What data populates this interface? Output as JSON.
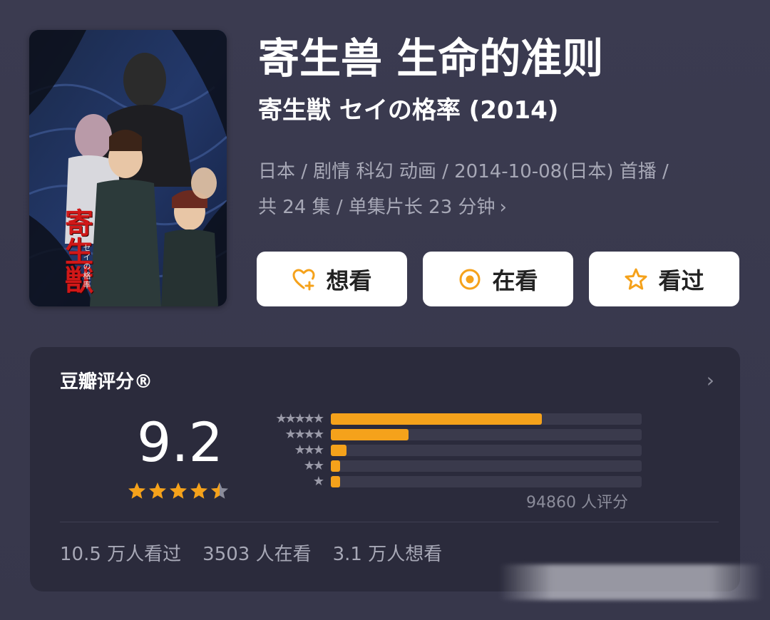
{
  "poster": {
    "title": "寄生獣",
    "subtitle": "セイの格率"
  },
  "header": {
    "title": "寄生兽 生命的准则",
    "subtitle": "寄生獣 セイの格率 (2014)"
  },
  "meta": {
    "line1": "日本 / 剧情 科幻 动画 / 2014-10-08(日本) 首播 /",
    "line2": "共 24 集 / 单集片长 23 分钟",
    "chevron": "›"
  },
  "actions": [
    {
      "label": "想看",
      "icon": "heart-plus-icon"
    },
    {
      "label": "在看",
      "icon": "target-circle-icon"
    },
    {
      "label": "看过",
      "icon": "star-outline-icon"
    }
  ],
  "rating": {
    "header": "豆瓣评分®",
    "chevron": "›",
    "score": "9.2",
    "stars_value": 4.5,
    "distribution": [
      {
        "stars": "★★★★★",
        "fraction": 0.68
      },
      {
        "stars": "★★★★",
        "fraction": 0.25
      },
      {
        "stars": "★★★",
        "fraction": 0.05
      },
      {
        "stars": "★★",
        "fraction": 0.03
      },
      {
        "stars": "★",
        "fraction": 0.03
      }
    ],
    "count": "94860 人评分",
    "stats": {
      "watched": "10.5 万人看过",
      "watching": "3503 人在看",
      "want": "3.1 万人想看"
    }
  },
  "colors": {
    "accent": "#f5a21b",
    "background": "#3a3a4e",
    "card": "#2b2b3c"
  }
}
